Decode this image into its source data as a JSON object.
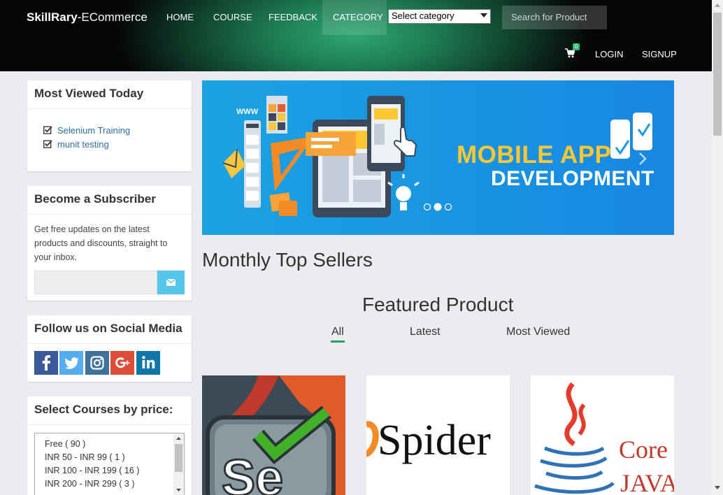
{
  "navbar": {
    "brand_bold": "SkillRary",
    "brand_rest": "-ECommerce",
    "links": [
      "HOME",
      "COURSE",
      "FEEDBACK",
      "CATEGORY"
    ],
    "active_link": "CATEGORY",
    "category_select": "Select category",
    "search_placeholder": "Search for Product",
    "cart_count": "0",
    "login": "LOGIN",
    "signup": "SIGNUP"
  },
  "sidebar": {
    "most_viewed": {
      "title": "Most Viewed Today",
      "items": [
        "Selenium Training",
        "munit testing"
      ]
    },
    "subscriber": {
      "title": "Become a Subscriber",
      "text": "Get free updates on the latest products and discounts, straight to your inbox."
    },
    "social": {
      "title": "Follow us on Social Media",
      "icons": [
        "facebook-icon",
        "twitter-icon",
        "instagram-icon",
        "google-plus-icon",
        "linkedin-icon"
      ]
    },
    "price": {
      "title": "Select Courses by price:",
      "options": [
        "Free ( 90 )",
        "INR 50 - INR 99 ( 1 )",
        "INR 100 - INR 199 ( 16 )",
        "INR 200 - INR 299 ( 3 )"
      ]
    }
  },
  "banner": {
    "line1": "MOBILE APP",
    "line2": "DEVELOPMENT",
    "www": "WWW",
    "slides": 3,
    "active_slide": 2
  },
  "main": {
    "monthly_heading": "Monthly Top Sellers",
    "featured_heading": "Featured Product",
    "tabs": [
      "All",
      "Latest",
      "Most Viewed"
    ],
    "active_tab": "All",
    "products": [
      {
        "logo_text": "Se"
      },
      {
        "logo_text": "Spider"
      },
      {
        "logo_text_1": "Core",
        "logo_text_2": "JAVA"
      }
    ]
  },
  "colors": {
    "accent_green": "#2f9c6e",
    "link_blue": "#2f6fa3",
    "banner_blue": "#1a9be3",
    "banner_yellow": "#ffc832",
    "subscribe_button": "#55c5e9"
  }
}
